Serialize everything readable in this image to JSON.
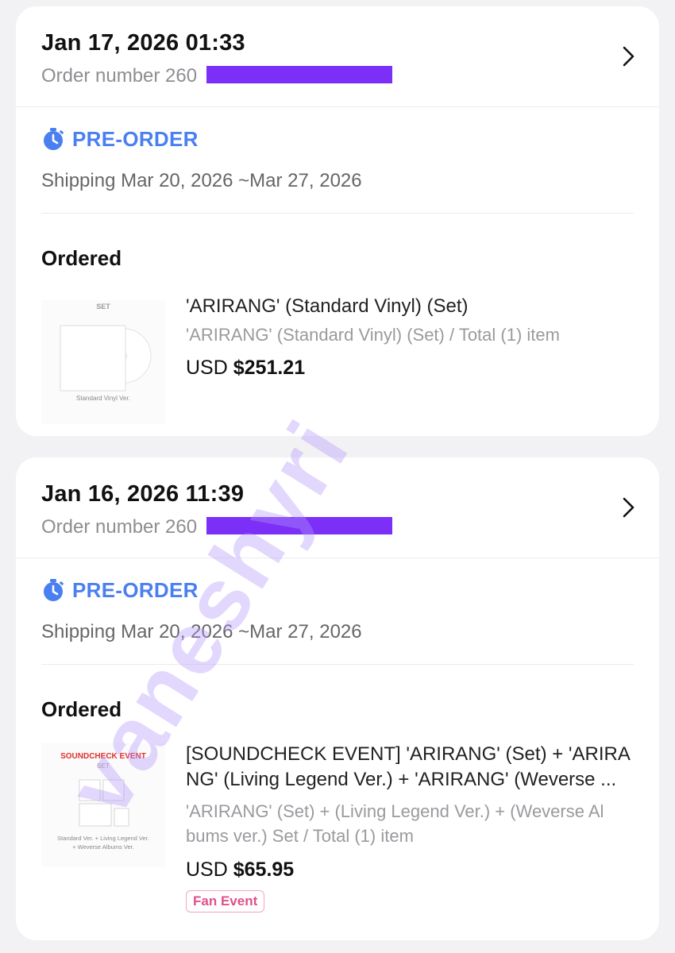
{
  "orders": [
    {
      "date": "Jan 17, 2026 01:33",
      "order_number_label": "Order number 260",
      "preorder_label": "PRE-ORDER",
      "shipping": "Shipping Mar 20, 2026 ~Mar 27, 2026",
      "section_heading": "Ordered",
      "item": {
        "thumb_top_text": "SET",
        "thumb_caption": "Standard Vinyl Ver.",
        "name": "'ARIRANG' (Standard Vinyl) (Set)",
        "sub": "'ARIRANG' (Standard Vinyl) (Set) / Total (1) item",
        "currency": "USD",
        "amount": "$251.21"
      }
    },
    {
      "date": "Jan 16, 2026 11:39",
      "order_number_label": "Order number 260",
      "preorder_label": "PRE-ORDER",
      "shipping": "Shipping Mar 20, 2026 ~Mar 27, 2026",
      "section_heading": "Ordered",
      "item": {
        "thumb_event_text": "SOUNDCHECK EVENT",
        "thumb_top_text": "SET",
        "thumb_caption_1": "Standard Ver. + Living Legend Ver.",
        "thumb_caption_2": "+ Weverse Albums Ver.",
        "name_line_1": "[SOUNDCHECK EVENT] 'ARIRANG' (Set) + 'ARIRA",
        "name_line_2": "NG' (Living Legend Ver.) + 'ARIRANG' (Weverse ...",
        "sub_line_1": "'ARIRANG' (Set) + (Living Legend Ver.) + (Weverse Al",
        "sub_line_2": "bums ver.) Set / Total (1) item",
        "currency": "USD",
        "amount": "$65.95",
        "badge": "Fan Event"
      }
    }
  ],
  "watermark": "vaneshyri",
  "colors": {
    "accent_blue": "#4a7ff0",
    "redaction": "#7b2ff7",
    "badge_pink": "#e0508b",
    "event_red": "#e0312f",
    "background": "#f2f2f4"
  },
  "icons": {
    "preorder": "stopwatch-icon",
    "chevron": "chevron-right-icon"
  }
}
